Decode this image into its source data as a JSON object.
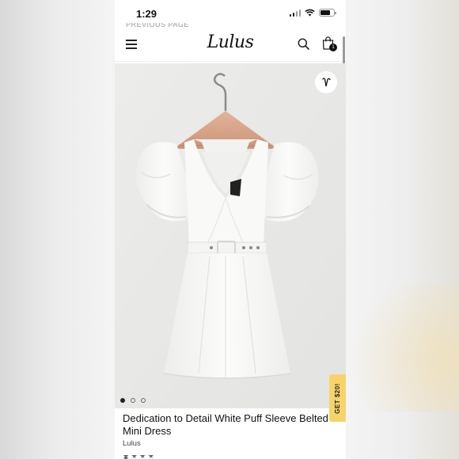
{
  "status_bar": {
    "time": "1:29"
  },
  "header": {
    "logo": "Lulus",
    "cart_count": "1",
    "cut_text": "PREVIOUS PAGE"
  },
  "product": {
    "title": "Dedication to Detail White Puff Sleeve Belted Mini Dress",
    "brand": "Lulus",
    "image_count": 3,
    "active_image": 1
  },
  "promo": {
    "label": "GET $20!"
  },
  "icons": {
    "menu": "hamburger-menu-icon",
    "search": "search-icon",
    "bag": "shopping-bag-icon",
    "wishlist": "heart-icon"
  },
  "colors": {
    "promo": "#f7d46a",
    "image_bg": "#e9e9e7"
  }
}
